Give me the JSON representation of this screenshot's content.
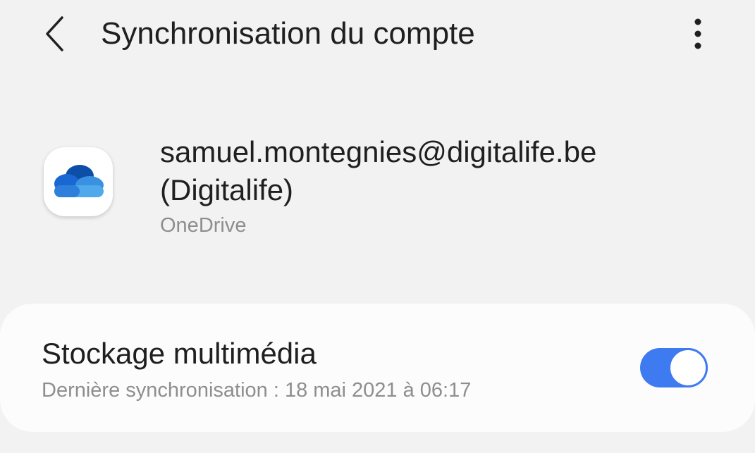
{
  "app_bar": {
    "back_icon": "chevron-left-icon",
    "title": "Synchronisation du compte",
    "more_icon": "more-vert-icon"
  },
  "account": {
    "app_icon": "onedrive-icon",
    "email": "samuel.montegnies@digitalife.be",
    "organization": "(Digitalife)",
    "type": "OneDrive"
  },
  "sync_items": [
    {
      "title": "Stockage multimédia",
      "subtitle": "Dernière synchronisation : 18 mai 2021 à 06:17",
      "enabled": true
    }
  ],
  "colors": {
    "background": "#f2f2f2",
    "card": "#fcfcfc",
    "toggle_on": "#3e7bf0",
    "secondary_text": "#8e8e8e"
  }
}
